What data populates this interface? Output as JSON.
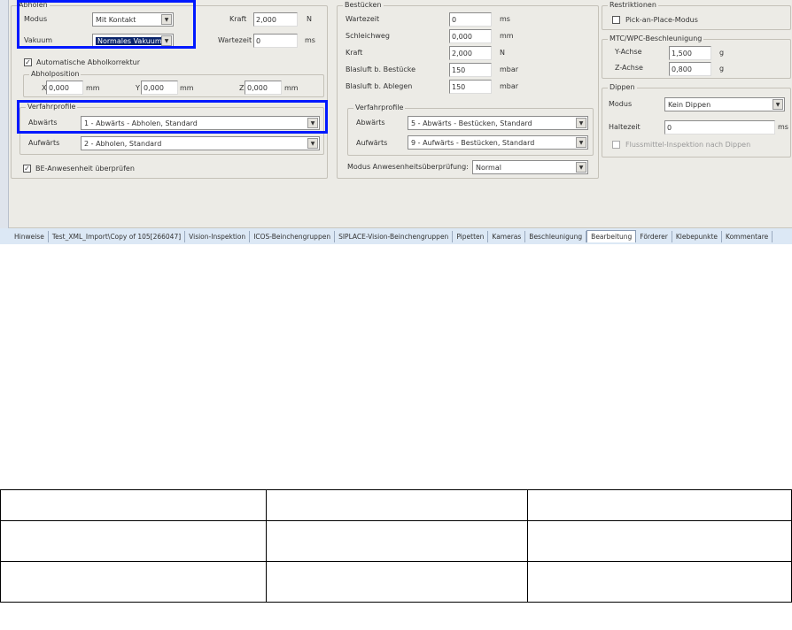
{
  "abholen": {
    "title": "Abholen",
    "modus_label": "Modus",
    "modus_value": "Mit Kontakt",
    "vakuum_label": "Vakuum",
    "vakuum_value": "Normales Vakuum",
    "kraft_label": "Kraft",
    "kraft_value": "2,000",
    "kraft_unit": "N",
    "wartezeit_label": "Wartezeit",
    "wartezeit_value": "0",
    "wartezeit_unit": "ms",
    "auto_korrektur_label": "Automatische Abholkorrektur",
    "auto_korrektur_checked": true,
    "position": {
      "title": "Abholposition",
      "x_label": "X",
      "x_value": "0,000",
      "y_label": "Y",
      "y_value": "0,000",
      "z_label": "Z",
      "z_value": "0,000",
      "unit": "mm"
    },
    "profile": {
      "title": "Verfahrprofile",
      "ab_label": "Abwärts",
      "ab_value": "1 - Abwärts - Abholen, Standard",
      "auf_label": "Aufwärts",
      "auf_value": "2 - Abholen, Standard"
    },
    "be_check_label": "BE-Anwesenheit überprüfen",
    "be_check_checked": true
  },
  "bestuecken": {
    "title": "Bestücken",
    "fields": [
      {
        "label": "Wartezeit",
        "value": "0",
        "unit": "ms"
      },
      {
        "label": "Schleichweg",
        "value": "0,000",
        "unit": "mm"
      },
      {
        "label": "Kraft",
        "value": "2,000",
        "unit": "N"
      },
      {
        "label": "Blasluft b. Bestücke",
        "value": "150",
        "unit": "mbar"
      },
      {
        "label": "Blasluft b. Ablegen",
        "value": "150",
        "unit": "mbar"
      }
    ],
    "profile": {
      "title": "Verfahrprofile",
      "ab_label": "Abwärts",
      "ab_value": "5 - Abwärts - Bestücken, Standard",
      "auf_label": "Aufwärts",
      "auf_value": "9 - Aufwärts - Bestücken, Standard"
    },
    "modus_label": "Modus Anwesenheitsüberprüfung:",
    "modus_value": "Normal"
  },
  "restriktionen": {
    "title": "Restriktionen",
    "pick_label": "Pick-an-Place-Modus",
    "pick_checked": false
  },
  "beschleunigung": {
    "title": "MTC/WPC-Beschleunigung",
    "y_label": "Y-Achse",
    "y_value": "1,500",
    "z_label": "Z-Achse",
    "z_value": "0,800",
    "unit": "g"
  },
  "dippen": {
    "title": "Dippen",
    "modus_label": "Modus",
    "modus_value": "Kein Dippen",
    "haltezeit_label": "Haltezeit",
    "haltezeit_value": "0",
    "haltezeit_unit": "ms",
    "fluss_label": "Flussmittel-Inspektion nach Dippen",
    "fluss_checked": false
  },
  "tabs": [
    "Hinweise",
    "Test_XML_Import\\Copy of 105[266047]",
    "Vision-Inspektion",
    "ICOS-Beinchengruppen",
    "SIPLACE-Vision-Beinchengruppen",
    "Pipetten",
    "Kameras",
    "Beschleunigung",
    "Bearbeitung",
    "Förderer",
    "Klebepunkte",
    "Kommentare"
  ],
  "active_tab": "Bearbeitung",
  "highlight_color": "#0019ff"
}
